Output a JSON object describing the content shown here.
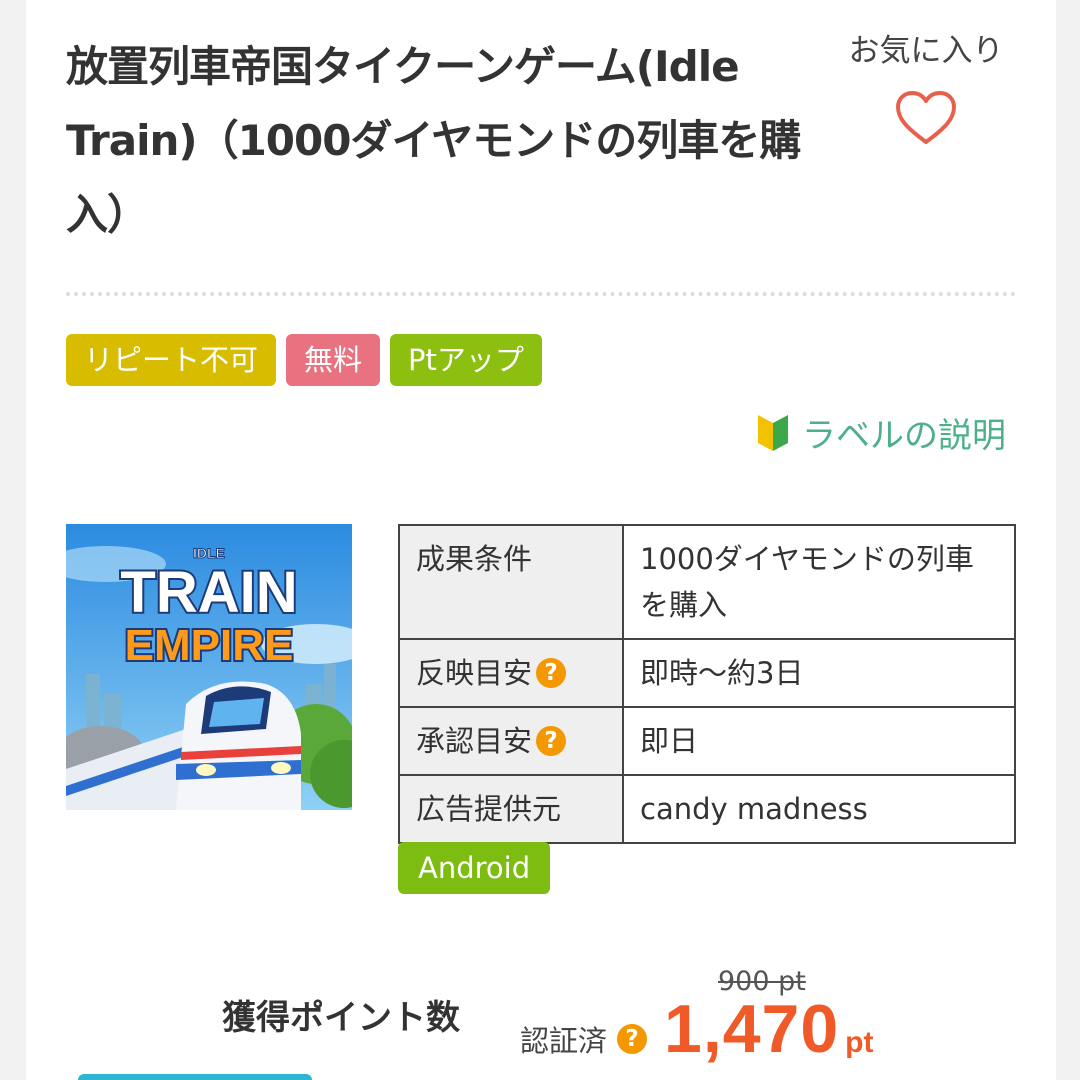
{
  "title": "放置列車帝国タイクーンゲーム(Idle Train)（1000ダイヤモンドの列車を購入）",
  "favorite": {
    "label": "お気に入り",
    "icon": "heart-outline-icon",
    "color": "#e8604c"
  },
  "badges": [
    {
      "label": "リピート不可",
      "color": "#d7bc00"
    },
    {
      "label": "無料",
      "color": "#e8727f"
    },
    {
      "label": "Ptアップ",
      "color": "#8cbf10"
    }
  ],
  "label_help": {
    "text": "ラベルの説明",
    "icon": "beginner-mark-icon",
    "color": "#4db08a"
  },
  "app_image": {
    "line1": "IDLE",
    "line2": "TRAIN",
    "line3": "EMPIRE"
  },
  "info": {
    "rows": [
      {
        "key": "成果条件",
        "value": "1000ダイヤモンドの列車を購入",
        "help": false
      },
      {
        "key": "反映目安",
        "value": "即時〜約3日",
        "help": true
      },
      {
        "key": "承認目安",
        "value": "即日",
        "help": true
      },
      {
        "key": "広告提供元",
        "value": "candy madness",
        "help": false
      }
    ],
    "help_glyph": "?"
  },
  "platform": "Android",
  "points": {
    "label": "獲得ポイント数",
    "old": "900 pt",
    "verified": "認証済",
    "value": "1,470",
    "unit": "pt",
    "color": "#f05a28"
  }
}
